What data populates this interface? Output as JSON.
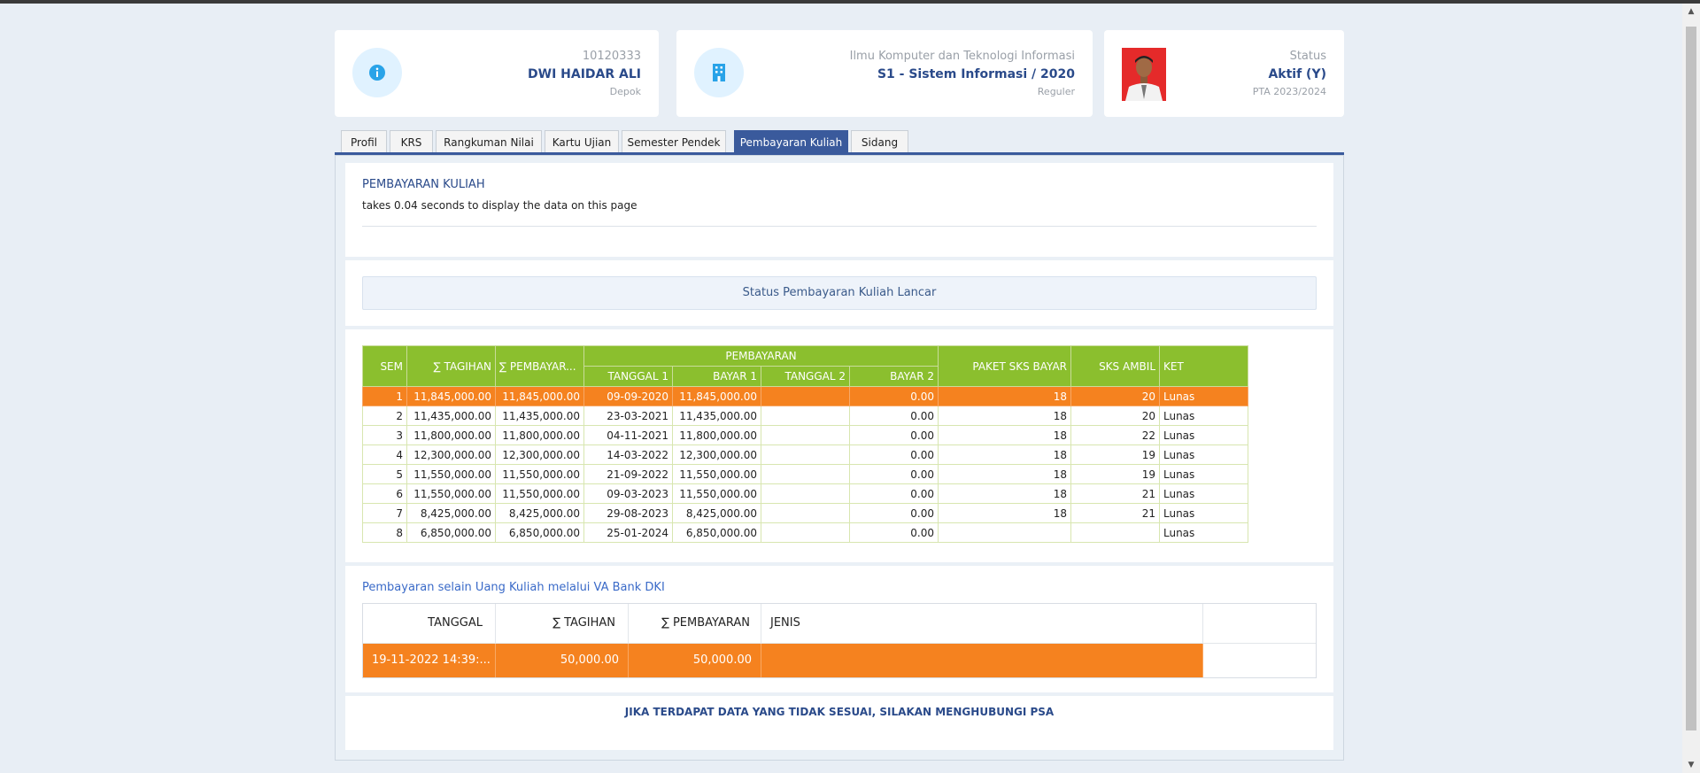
{
  "student": {
    "nim": "10120333",
    "name": "DWI HAIDAR ALI",
    "campus": "Depok",
    "faculty": "Ilmu Komputer dan Teknologi Informasi",
    "program": "S1 - Sistem Informasi / 2020",
    "class_type": "Reguler",
    "status_label": "Status",
    "status_value": "Aktif (Y)",
    "academic_year": "PTA 2023/2024"
  },
  "tabs": [
    "Profil",
    "KRS",
    "Rangkuman Nilai",
    "Kartu Ujian",
    "Semester Pendek",
    "Pembayaran Kuliah",
    "Sidang"
  ],
  "active_tab": "Pembayaran Kuliah",
  "page": {
    "title": "PEMBAYARAN KULIAH",
    "subtitle": "takes 0.04 seconds to display the data on this page",
    "status_message": "Status Pembayaran Kuliah Lancar"
  },
  "payments_table": {
    "headers": {
      "sem": "SEM",
      "tagihan": "∑ TAGIHAN",
      "pembayaran": "∑ PEMBAYAR...",
      "group": "PEMBAYARAN",
      "tanggal1": "TANGGAL 1",
      "bayar1": "BAYAR 1",
      "tanggal2": "TANGGAL 2",
      "bayar2": "BAYAR 2",
      "paket": "PAKET SKS BAYAR",
      "sks": "SKS AMBIL",
      "ket": "KET"
    },
    "rows": [
      {
        "sem": "1",
        "tagihan": "11,845,000.00",
        "pembayaran": "11,845,000.00",
        "tanggal1": "09-09-2020",
        "bayar1": "11,845,000.00",
        "tanggal2": "",
        "bayar2": "0.00",
        "paket": "18",
        "sks": "20",
        "ket": "Lunas"
      },
      {
        "sem": "2",
        "tagihan": "11,435,000.00",
        "pembayaran": "11,435,000.00",
        "tanggal1": "23-03-2021",
        "bayar1": "11,435,000.00",
        "tanggal2": "",
        "bayar2": "0.00",
        "paket": "18",
        "sks": "20",
        "ket": "Lunas"
      },
      {
        "sem": "3",
        "tagihan": "11,800,000.00",
        "pembayaran": "11,800,000.00",
        "tanggal1": "04-11-2021",
        "bayar1": "11,800,000.00",
        "tanggal2": "",
        "bayar2": "0.00",
        "paket": "18",
        "sks": "22",
        "ket": "Lunas"
      },
      {
        "sem": "4",
        "tagihan": "12,300,000.00",
        "pembayaran": "12,300,000.00",
        "tanggal1": "14-03-2022",
        "bayar1": "12,300,000.00",
        "tanggal2": "",
        "bayar2": "0.00",
        "paket": "18",
        "sks": "19",
        "ket": "Lunas"
      },
      {
        "sem": "5",
        "tagihan": "11,550,000.00",
        "pembayaran": "11,550,000.00",
        "tanggal1": "21-09-2022",
        "bayar1": "11,550,000.00",
        "tanggal2": "",
        "bayar2": "0.00",
        "paket": "18",
        "sks": "19",
        "ket": "Lunas"
      },
      {
        "sem": "6",
        "tagihan": "11,550,000.00",
        "pembayaran": "11,550,000.00",
        "tanggal1": "09-03-2023",
        "bayar1": "11,550,000.00",
        "tanggal2": "",
        "bayar2": "0.00",
        "paket": "18",
        "sks": "21",
        "ket": "Lunas"
      },
      {
        "sem": "7",
        "tagihan": "8,425,000.00",
        "pembayaran": "8,425,000.00",
        "tanggal1": "29-08-2023",
        "bayar1": "8,425,000.00",
        "tanggal2": "",
        "bayar2": "0.00",
        "paket": "18",
        "sks": "21",
        "ket": "Lunas"
      },
      {
        "sem": "8",
        "tagihan": "6,850,000.00",
        "pembayaran": "6,850,000.00",
        "tanggal1": "25-01-2024",
        "bayar1": "6,850,000.00",
        "tanggal2": "",
        "bayar2": "0.00",
        "paket": "",
        "sks": "",
        "ket": "Lunas"
      }
    ]
  },
  "other_payments": {
    "title": "Pembayaran selain Uang Kuliah melalui VA Bank DKI",
    "headers": {
      "tanggal": "TANGGAL",
      "tagihan": "∑ TAGIHAN",
      "pembayaran": "∑ PEMBAYARAN",
      "jenis": "JENIS"
    },
    "row": {
      "tanggal": "19-11-2022 14:39:...",
      "tagihan": "50,000.00",
      "pembayaran": "50,000.00",
      "jenis": ""
    }
  },
  "footer_note": "JIKA TERDAPAT DATA YANG TIDAK SESUAI, SILAKAN MENGHUBUNGI PSA",
  "colors": {
    "accent": "#3a5a9c",
    "table_header": "#8bbf2e",
    "highlight": "#f5821f"
  },
  "icons": {
    "card1": "info-icon",
    "card2": "building-icon"
  }
}
